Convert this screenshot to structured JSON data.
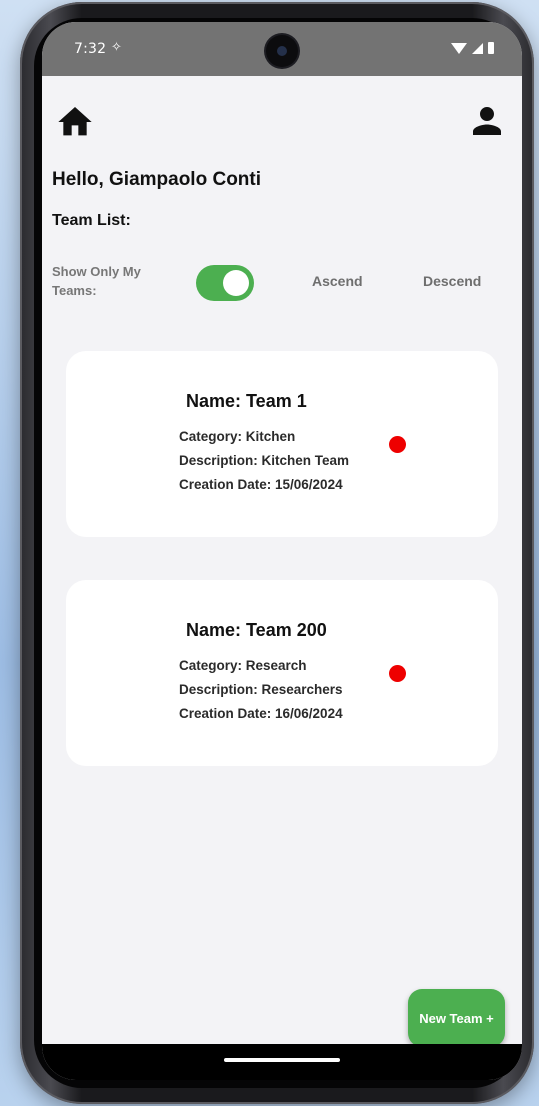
{
  "status_bar": {
    "time": "7:32",
    "extra_icon": "✧"
  },
  "header": {
    "home_icon": "home-icon",
    "profile_icon": "person-icon"
  },
  "greeting": "Hello, Giampaolo Conti",
  "team_list_label": "Team List:",
  "filters": {
    "show_only_label": "Show Only My Teams:",
    "toggle_on": true,
    "ascend_label": "Ascend",
    "descend_label": "Descend"
  },
  "teams": [
    {
      "name": "Name: Team 1",
      "category": "Category: Kitchen",
      "description": "Description: Kitchen Team",
      "creation_date": "Creation Date: 15/06/2024",
      "status_color": "#ee0000"
    },
    {
      "name": "Name: Team 200",
      "category": "Category: Research",
      "description": "Description: Researchers",
      "creation_date": "Creation Date: 16/06/2024",
      "status_color": "#ee0000"
    }
  ],
  "new_team_button": "New Team +",
  "colors": {
    "accent": "#4caf50",
    "status_bar": "#737373",
    "background": "#f3f3f6"
  }
}
